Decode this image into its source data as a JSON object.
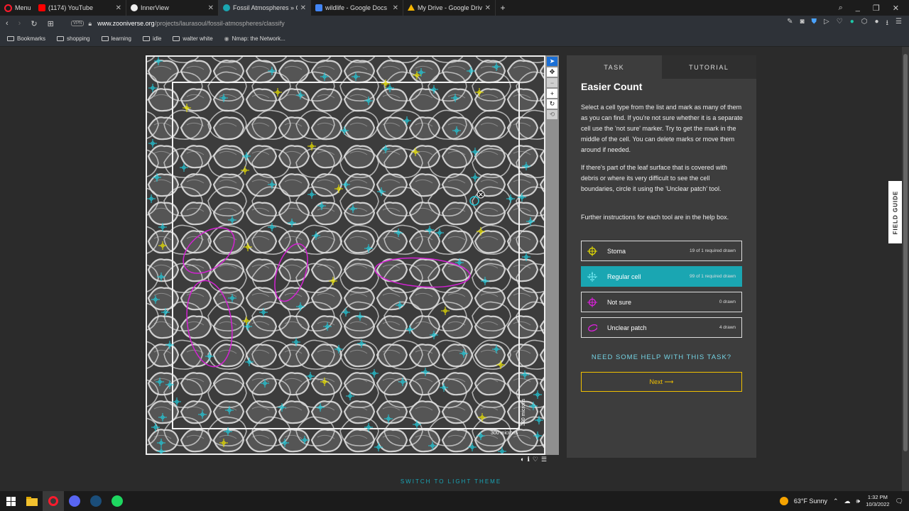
{
  "browser": {
    "menu_label": "Menu",
    "tabs": [
      {
        "title": "(1174) YouTube",
        "color": "#ff0000"
      },
      {
        "title": "InnerView",
        "color": "#ffffff"
      },
      {
        "title": "Fossil Atmospheres » Class",
        "color": "#1aa6b2"
      },
      {
        "title": "wildlife - Google Docs",
        "color": "#4285f4"
      },
      {
        "title": "My Drive - Google Drive",
        "color": "#f4b400"
      }
    ],
    "new_tab": "+",
    "vpn_label": "VPN",
    "url_domain": "www.zooniverse.org",
    "url_path": "/projects/laurasoul/fossil-atmospheres/classify",
    "bookmarks": [
      "Bookmarks",
      "shopping",
      "learning",
      "idle",
      "walter white",
      "Nmap: the Network..."
    ]
  },
  "subject": {
    "scale_x": "300 microns",
    "scale_y": "300 microns"
  },
  "task": {
    "tab_task": "TASK",
    "tab_tutorial": "TUTORIAL",
    "title": "Easier Count",
    "para1": "Select a cell type from the list and mark as many of them as you can find. If you're not sure whether it is a separate cell use the 'not sure' marker. Try to get the mark in the middle of the cell. You can delete marks or move them around if needed.",
    "para2": "If there's part of the leaf surface that is covered with debris or where its very difficult to see the cell boundaries, circle it using the 'Unclear patch' tool.",
    "para3": "Further instructions for each tool are in the help box.",
    "options": [
      {
        "label": "Stoma",
        "count": "19 of 1 required drawn",
        "color": "#e8e000"
      },
      {
        "label": "Regular cell",
        "count": "99 of 1 required drawn",
        "color": "#22c8d8"
      },
      {
        "label": "Not sure",
        "count": "0 drawn",
        "color": "#e020e0"
      },
      {
        "label": "Unclear patch",
        "count": "4 drawn",
        "color": "#e020e0"
      }
    ],
    "help": "NEED SOME HELP WITH THIS TASK?",
    "next": "Next ⟶"
  },
  "field_guide": "FIELD GUIDE",
  "theme_switch": "SWITCH TO LIGHT THEME",
  "taskbar": {
    "weather": "63°F  Sunny",
    "time": "1:32 PM",
    "date": "10/3/2022"
  },
  "colors": {
    "accent": "#1aa6b2",
    "regular_marker": "#22c8d8",
    "stoma_marker": "#e8e000",
    "patch": "#d422d4",
    "next": "#f0c000"
  }
}
